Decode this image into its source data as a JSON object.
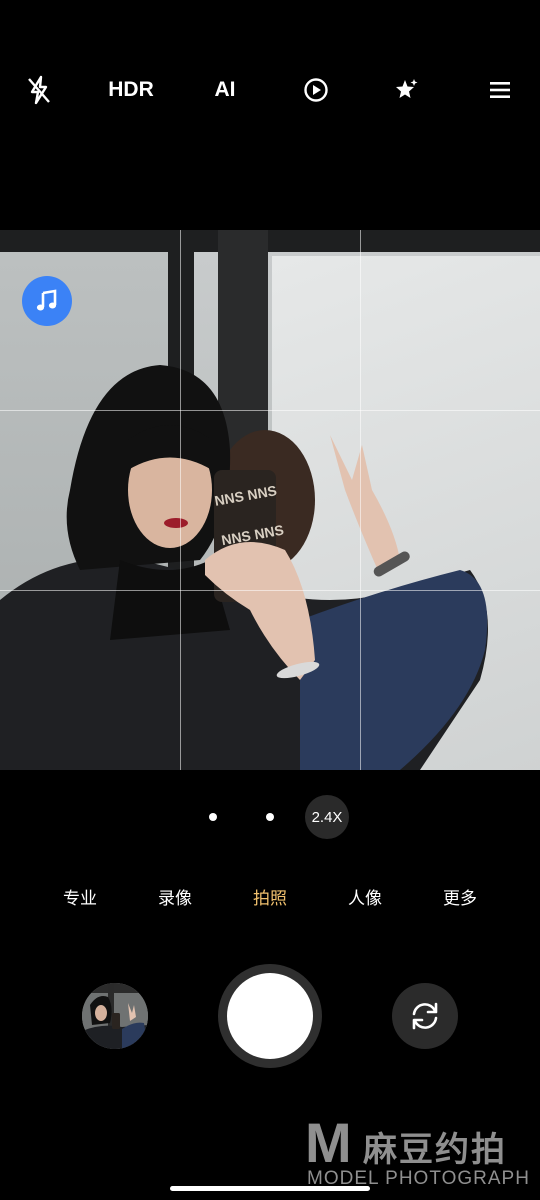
{
  "top_bar": {
    "flash_icon": "flash-off-icon",
    "hdr_label": "HDR",
    "ai_label": "AI",
    "motion_icon": "live-photo-icon",
    "beauty_icon": "magic-star-icon",
    "menu_icon": "menu-icon"
  },
  "viewfinder": {
    "grid": true,
    "music_icon": "music-note-icon",
    "accent_color": "#3b82f6"
  },
  "zoom": {
    "current": "2.4X"
  },
  "modes": {
    "items": [
      "专业",
      "录像",
      "拍照",
      "人像",
      "更多"
    ],
    "active": "拍照",
    "active_color": "#f0c06e"
  },
  "controls": {
    "gallery_icon": "gallery-thumbnail",
    "shutter_icon": "shutter-button",
    "flip_icon": "switch-camera-icon"
  },
  "watermark": {
    "logo": "M",
    "cn": "麻豆约拍",
    "en": "MODEL PHOTOGRAPH"
  }
}
